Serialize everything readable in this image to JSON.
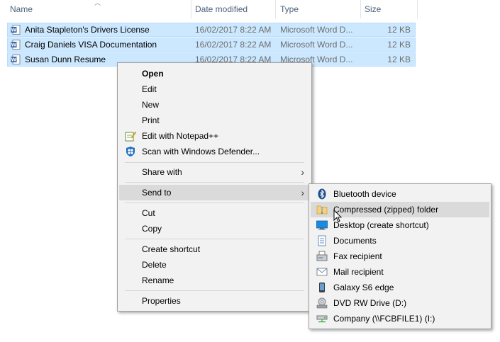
{
  "columns": {
    "name": "Name",
    "date": "Date modified",
    "type": "Type",
    "size": "Size"
  },
  "files": [
    {
      "name": "Anita Stapleton's Drivers License",
      "date": "16/02/2017 8:22 AM",
      "type": "Microsoft Word D...",
      "size": "12 KB"
    },
    {
      "name": "Craig Daniels VISA Documentation",
      "date": "16/02/2017 8:22 AM",
      "type": "Microsoft Word D...",
      "size": "12 KB"
    },
    {
      "name": "Susan Dunn Resume",
      "date": "16/02/2017 8:22 AM",
      "type": "Microsoft Word D...",
      "size": "12 KB"
    }
  ],
  "context_menu": {
    "open": "Open",
    "edit": "Edit",
    "new": "New",
    "print": "Print",
    "edit_notepad": "Edit with Notepad++",
    "scan_defender": "Scan with Windows Defender...",
    "share_with": "Share with",
    "send_to": "Send to",
    "cut": "Cut",
    "copy": "Copy",
    "create_shortcut": "Create shortcut",
    "delete": "Delete",
    "rename": "Rename",
    "properties": "Properties"
  },
  "send_to_menu": {
    "bluetooth": "Bluetooth device",
    "compressed": "Compressed (zipped) folder",
    "desktop": "Desktop (create shortcut)",
    "documents": "Documents",
    "fax": "Fax recipient",
    "mail": "Mail recipient",
    "galaxy": "Galaxy S6 edge",
    "dvd": "DVD RW Drive (D:)",
    "company": "Company (\\\\FCBFILE1) (I:)"
  },
  "colors": {
    "selection": "#cce8ff",
    "menu_bg": "#f2f2f2",
    "menu_highlight": "#dadada",
    "header_text": "#4c607a"
  }
}
